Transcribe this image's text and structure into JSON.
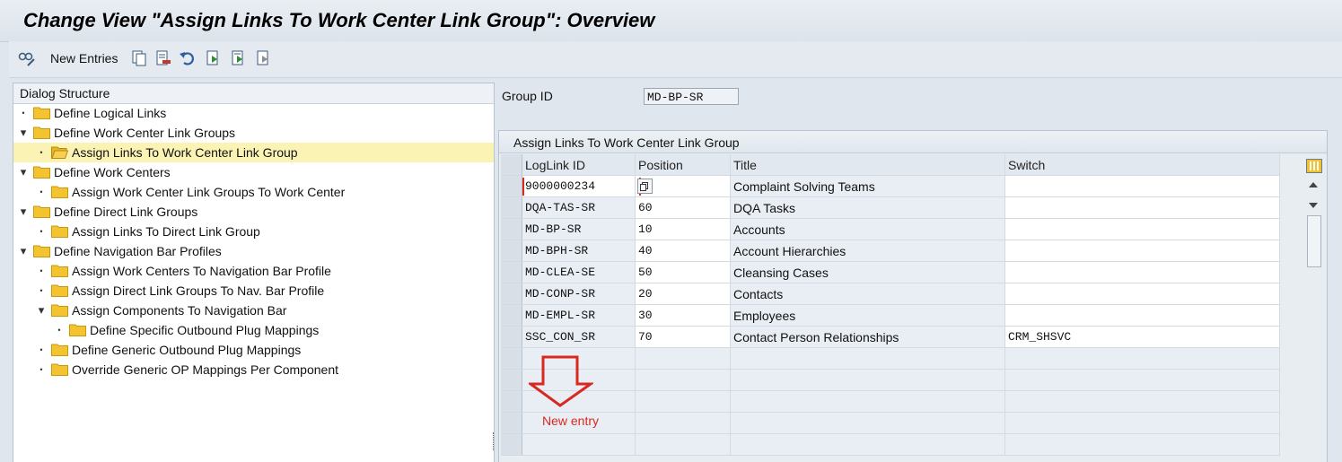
{
  "title": "Change View \"Assign Links To Work Center Link Group\": Overview",
  "toolbar": {
    "new_entries_label": "New Entries",
    "icons": [
      "glasses-pencil-icon",
      "copy-icon",
      "delete-icon",
      "undo-icon",
      "select-all-icon",
      "select-block-icon",
      "deselect-all-icon"
    ]
  },
  "dialog": {
    "header": "Dialog Structure",
    "items": [
      {
        "label": "Define Logical Links"
      },
      {
        "label": "Define Work Center Link Groups"
      },
      {
        "label": "Assign Links To Work Center Link Group"
      },
      {
        "label": "Define Work Centers"
      },
      {
        "label": "Assign Work Center Link Groups To Work Center"
      },
      {
        "label": "Define Direct Link Groups"
      },
      {
        "label": "Assign Links To Direct Link Group"
      },
      {
        "label": "Define Navigation Bar Profiles"
      },
      {
        "label": "Assign Work Centers To Navigation Bar Profile"
      },
      {
        "label": "Assign Direct Link Groups To Nav. Bar Profile"
      },
      {
        "label": "Assign Components To Navigation Bar"
      },
      {
        "label": "Define Specific Outbound Plug Mappings"
      },
      {
        "label": "Define Generic Outbound Plug Mappings"
      },
      {
        "label": "Override Generic OP Mappings Per Component"
      }
    ]
  },
  "group": {
    "label": "Group ID",
    "value": "MD-BP-SR"
  },
  "table": {
    "title": "Assign Links To Work Center Link Group",
    "columns": [
      "LogLink ID",
      "Position",
      "Title",
      "Switch"
    ],
    "rows": [
      {
        "id": "9000000234",
        "pos": "",
        "title": "Complaint Solving Teams",
        "switch": ""
      },
      {
        "id": "DQA-TAS-SR",
        "pos": "60",
        "title": "DQA Tasks",
        "switch": ""
      },
      {
        "id": "MD-BP-SR",
        "pos": "10",
        "title": "Accounts",
        "switch": ""
      },
      {
        "id": "MD-BPH-SR",
        "pos": "40",
        "title": "Account Hierarchies",
        "switch": ""
      },
      {
        "id": "MD-CLEA-SE",
        "pos": "50",
        "title": "Cleansing Cases",
        "switch": ""
      },
      {
        "id": "MD-CONP-SR",
        "pos": "20",
        "title": "Contacts",
        "switch": ""
      },
      {
        "id": "MD-EMPL-SR",
        "pos": "30",
        "title": "Employees",
        "switch": ""
      },
      {
        "id": "SSC_CON_SR",
        "pos": "70",
        "title": "Contact Person Relationships",
        "switch": "CRM_SHSVC"
      }
    ],
    "empty_rows": 5
  },
  "annotation": {
    "text": "New entry",
    "color": "#d9281f"
  },
  "colors": {
    "folder": "#f4c430",
    "selected_row": "#fbf3b4",
    "accent_red": "#d9281f"
  }
}
